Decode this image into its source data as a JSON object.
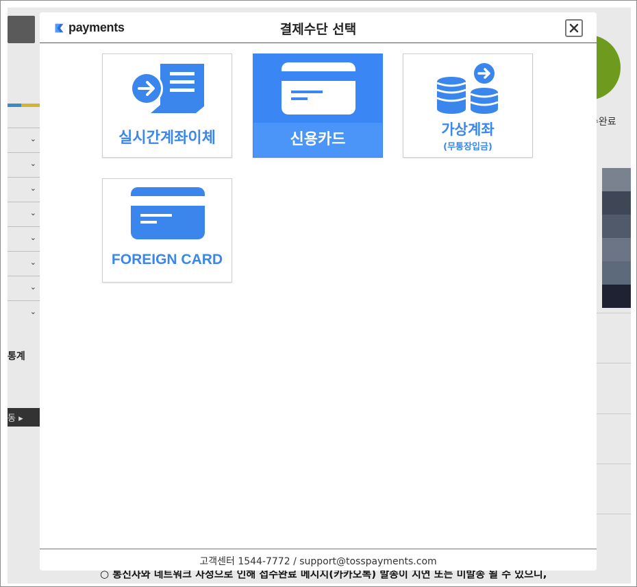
{
  "background": {
    "stat_label": "통계",
    "dark_label": "동",
    "done_label": "수완료",
    "notice": "○ 통신사와 네트워크 사정으로 인해 접수완료 메시지(카카오톡) 발송이 지연 또는 미발송 될 수 있으니,"
  },
  "modal": {
    "logo_text": "payments",
    "title": "결제수단 선택",
    "close_symbol": "✕",
    "methods": [
      {
        "label": "실시간계좌이체",
        "sub": "",
        "icon": "bank-transfer-icon"
      },
      {
        "label": "신용카드",
        "sub": "",
        "icon": "credit-card-icon",
        "selected": true
      },
      {
        "label": "가상계좌",
        "sub": "(무통장입금)",
        "icon": "coin-stack-icon"
      },
      {
        "label": "FOREIGN CARD",
        "sub": "",
        "icon": "foreign-card-icon"
      }
    ],
    "footer": "고객센터 1544-7772 / support@tosspayments.com"
  },
  "colors": {
    "accent": "#3a86ec",
    "selected_bg": "#3b86f5"
  }
}
